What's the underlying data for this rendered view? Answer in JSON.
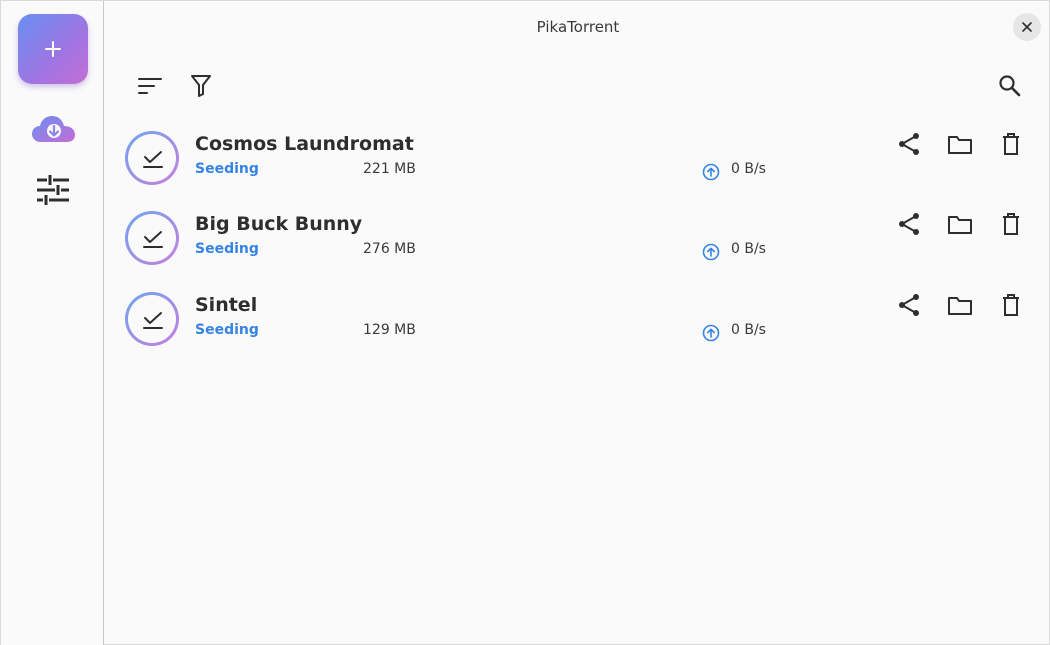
{
  "window": {
    "title": "PikaTorrent"
  },
  "torrents": [
    {
      "name": "Cosmos Laundromat",
      "status": "Seeding",
      "size": "221 MB",
      "speed": "0 B/s"
    },
    {
      "name": "Big Buck Bunny",
      "status": "Seeding",
      "size": "276 MB",
      "speed": "0 B/s"
    },
    {
      "name": "Sintel",
      "status": "Seeding",
      "size": "129 MB",
      "speed": "0 B/s"
    }
  ],
  "colors": {
    "accent": "#3584e4",
    "status_text": "#3584e4",
    "gradient_start": "#6a8ff2",
    "gradient_end": "#c56dd6"
  },
  "icons": {
    "sidebar": [
      "add-icon",
      "cloud-download-icon",
      "sliders-icon"
    ],
    "toolbar": [
      "sort-icon",
      "filter-icon",
      "search-icon"
    ],
    "row_actions": [
      "share-icon",
      "folder-icon",
      "trash-icon"
    ]
  }
}
